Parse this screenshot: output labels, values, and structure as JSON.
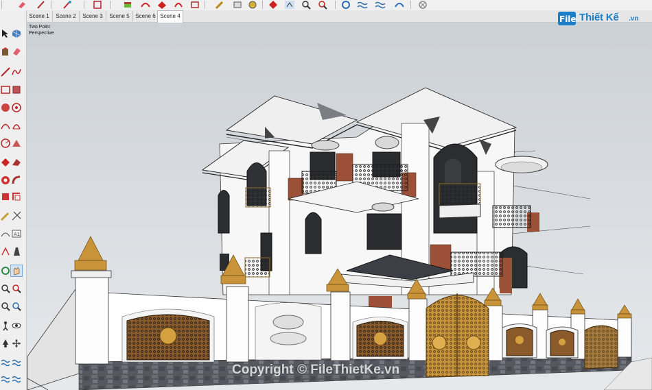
{
  "scenes": {
    "tabs": [
      "Scene 1",
      "Scene 2",
      "Scene 3",
      "Scene 5",
      "Scene 6",
      "Scene 4"
    ],
    "active": "Scene 4"
  },
  "viewport": {
    "camera_line1": "Two Point",
    "camera_line2": "Perspective"
  },
  "logo": {
    "brand": "FileThiết Kế",
    "suffix": ".vn",
    "color": "#1d7fc8"
  },
  "watermark": "Copyright © FileThietKe.vn",
  "toolbar_icons": [
    "eraser-icon",
    "pencil-icon",
    "paint-icon",
    "rectangle-icon",
    "book-icon",
    "orbit-icon",
    "follow-me-icon",
    "offset-icon",
    "tape-icon",
    "select-icon",
    "push-pull-icon",
    "rotate-icon",
    "move-icon",
    "zoom-icon",
    "zoom-extents-icon",
    "sandbox-icon",
    "water-icon",
    "walk-icon",
    "x-ray-icon"
  ],
  "left_tool_icons": [
    "select-arrow-icon",
    "component-icon",
    "paint-bucket-icon",
    "eraser-icon",
    "line-icon",
    "freehand-icon",
    "rectangle-icon",
    "rotated-rectangle-icon",
    "circle-icon",
    "polygon-icon",
    "arc-icon",
    "pie-icon",
    "push-pull-icon",
    "follow-me-icon",
    "move-icon",
    "rotate-icon",
    "scale-icon",
    "offset-icon",
    "tape-measure-icon",
    "text-icon",
    "protractor-icon",
    "axes-icon",
    "orbit-icon",
    "pan-icon",
    "zoom-icon",
    "zoom-window-icon",
    "walk-icon",
    "look-around-icon",
    "section-plane-icon",
    "position-camera-icon",
    "sandbox-icon",
    "water-icon"
  ],
  "colors": {
    "sky": "#d9dde1",
    "wall": "#ffffff",
    "gold": "#c9933a",
    "iron": "#2a2a2a",
    "brick": "#a0523a",
    "stone": "#5e6066"
  }
}
